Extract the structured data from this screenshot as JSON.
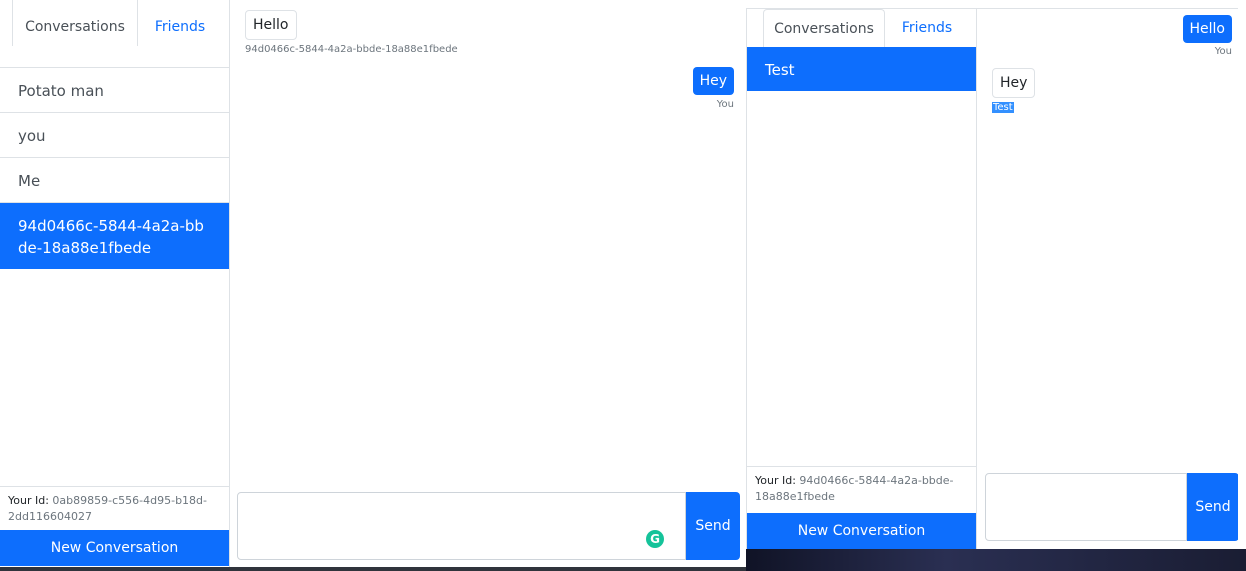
{
  "window_a": {
    "tabs": {
      "conversations": "Conversations",
      "friends": "Friends"
    },
    "conversations": [
      {
        "label": "Potato man",
        "active": false
      },
      {
        "label": "you",
        "active": false
      },
      {
        "label": "Me",
        "active": false
      },
      {
        "label": "94d0466c-5844-4a2a-bbde-18a88e1fbede",
        "active": true
      }
    ],
    "your_id_label": "Your Id:",
    "your_id_value": "0ab89859-c556-4d95-b18d-2dd116604027",
    "new_conversation": "New Conversation",
    "messages": [
      {
        "text": "Hello",
        "sender": "94d0466c-5844-4a2a-bbde-18a88e1fbede",
        "mine": false
      },
      {
        "text": "Hey",
        "sender": "You",
        "mine": true
      }
    ],
    "composer": {
      "value": "",
      "send_label": "Send"
    }
  },
  "window_b": {
    "tabs": {
      "conversations": "Conversations",
      "friends": "Friends"
    },
    "conversations": [
      {
        "label": "Test",
        "active": true
      }
    ],
    "your_id_label": "Your Id:",
    "your_id_value": "94d0466c-5844-4a2a-bbde-18a88e1fbede",
    "new_conversation": "New Conversation",
    "messages": [
      {
        "text": "Hello",
        "sender": "You",
        "mine": true
      },
      {
        "text": "Hey",
        "sender": "Test",
        "mine": false
      }
    ],
    "composer": {
      "value": "",
      "send_label": "Send"
    }
  },
  "icons": {
    "grammarly": "grammarly-icon",
    "grammarly_glyph": "G"
  },
  "colors": {
    "accent": "#0d6efd",
    "grammarly": "#15c39a"
  }
}
